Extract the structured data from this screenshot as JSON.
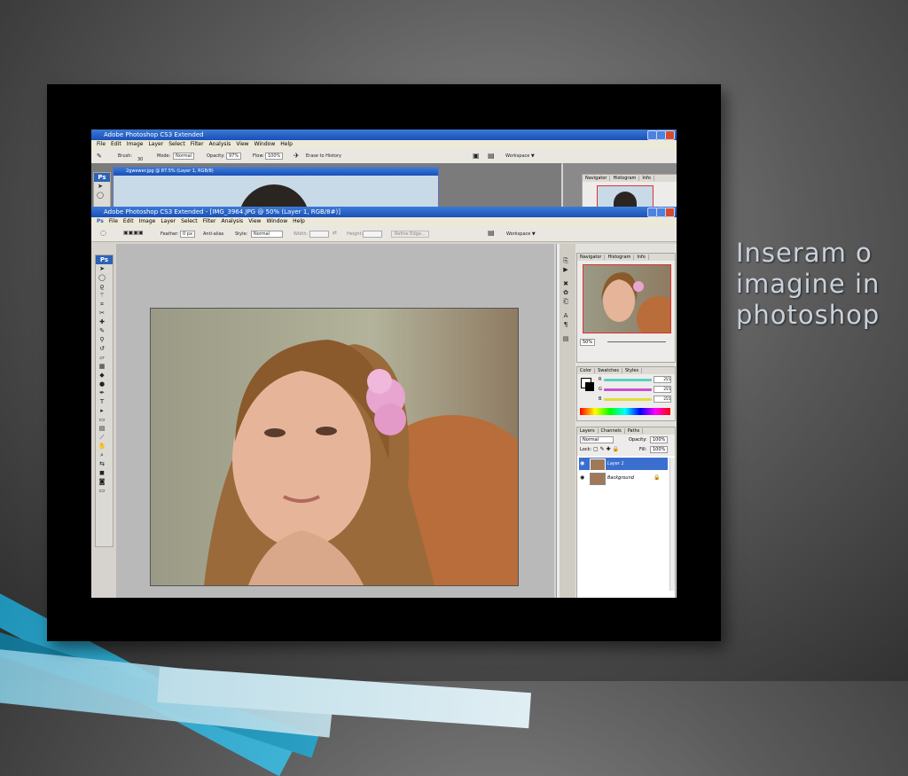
{
  "slide": {
    "title_lines": [
      "Inseram o",
      "imagine in",
      "photoshop"
    ]
  },
  "back_window": {
    "title": "Adobe Photoshop CS3 Extended",
    "menu": [
      "File",
      "Edit",
      "Image",
      "Layer",
      "Select",
      "Filter",
      "Analysis",
      "View",
      "Window",
      "Help"
    ],
    "options": {
      "brush_label": "Brush:",
      "brush_size": "30",
      "mode_label": "Mode:",
      "mode_value": "Normal",
      "opacity_label": "Opacity:",
      "opacity_value": "97%",
      "flow_label": "Flow:",
      "flow_value": "100%",
      "erase_to_history": "Erase to History",
      "workspace": "Workspace ▼"
    },
    "doc_title": "2gwewer.jpg @ 87.5% (Layer 1, RGB/8)",
    "panel_tabs": [
      "Navigator",
      "Histogram",
      "Info"
    ]
  },
  "front_window": {
    "title": "Adobe Photoshop CS3 Extended - [IMG_3964.JPG @ 50% (Layer 1, RGB/8#)]",
    "menu": [
      "File",
      "Edit",
      "Image",
      "Layer",
      "Select",
      "Filter",
      "Analysis",
      "View",
      "Window",
      "Help"
    ],
    "options": {
      "feather_label": "Feather:",
      "feather_value": "0 px",
      "anti_alias": "Anti-alias",
      "style_label": "Style:",
      "style_value": "Normal",
      "width_label": "Width:",
      "height_label": "Height:",
      "refine_edge": "Refine Edge...",
      "workspace": "Workspace ▼"
    },
    "navigator": {
      "tabs": [
        "Navigator",
        "Histogram",
        "Info"
      ],
      "zoom": "50%"
    },
    "color": {
      "tabs": [
        "Color",
        "Swatches",
        "Styles"
      ],
      "channels": [
        {
          "label": "R",
          "value": "255",
          "color": "#59d1c2"
        },
        {
          "label": "G",
          "value": "255",
          "color": "#c84fd0"
        },
        {
          "label": "B",
          "value": "255",
          "color": "#dede3a"
        }
      ]
    },
    "layers": {
      "tabs": [
        "Layers",
        "Channels",
        "Paths"
      ],
      "blend": "Normal",
      "opacity_label": "Opacity:",
      "opacity_value": "100%",
      "lock_label": "Lock:",
      "fill_label": "Fill:",
      "fill_value": "100%",
      "items": [
        {
          "name": "Layer 1",
          "selected": true
        },
        {
          "name": "Background",
          "selected": false
        }
      ]
    }
  },
  "icons": [
    "photoshop-logo-icon",
    "move-tool-icon",
    "lasso-tool-icon",
    "brush-tool-icon",
    "text-tool-icon",
    "zoom-tool-icon",
    "eye-icon",
    "lock-icon"
  ],
  "colors": {
    "xp_title": "#1a4fb8",
    "ps_blue": "#2d62b8",
    "accent_stripe": "#1c8fb4",
    "slide_text": "#c9d2dc"
  }
}
